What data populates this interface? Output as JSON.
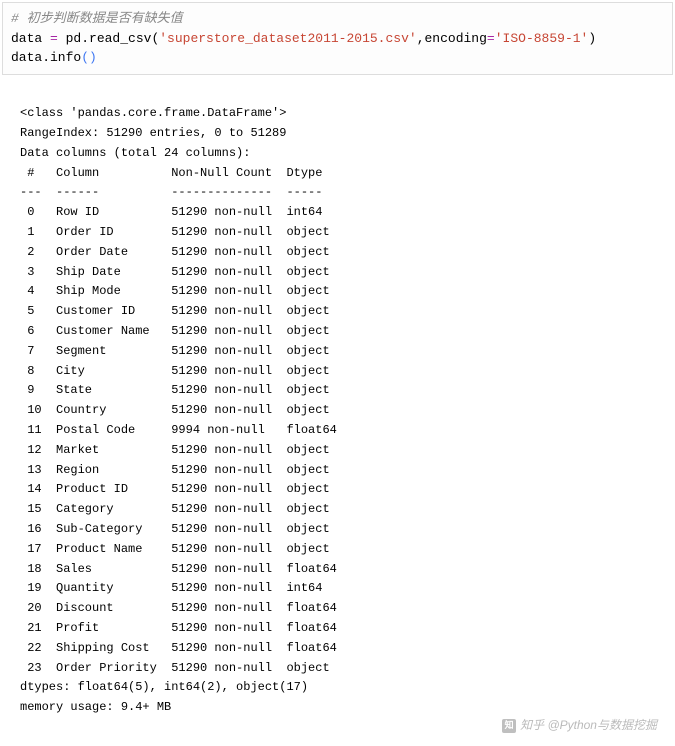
{
  "code": {
    "comment": "# 初步判断数据是否有缺失值",
    "line2_a": "data ",
    "line2_op": "=",
    "line2_b": " pd.read_csv(",
    "line2_str1": "'superstore_dataset2011-2015.csv'",
    "line2_c": ",encoding",
    "line2_op2": "=",
    "line2_str2": "'ISO-8859-1'",
    "line2_d": ")",
    "line3_a": "data.info",
    "line3_p1": "(",
    "line3_p2": ")"
  },
  "output": {
    "class_line": "<class 'pandas.core.frame.DataFrame'>",
    "range_index": "RangeIndex: 51290 entries, 0 to 51289",
    "data_cols": "Data columns (total 24 columns):",
    "header": " #   Column          Non-Null Count  Dtype  ",
    "divider": "---  ------          --------------  -----  ",
    "rows": [
      " 0   Row ID          51290 non-null  int64  ",
      " 1   Order ID        51290 non-null  object ",
      " 2   Order Date      51290 non-null  object ",
      " 3   Ship Date       51290 non-null  object ",
      " 4   Ship Mode       51290 non-null  object ",
      " 5   Customer ID     51290 non-null  object ",
      " 6   Customer Name   51290 non-null  object ",
      " 7   Segment         51290 non-null  object ",
      " 8   City            51290 non-null  object ",
      " 9   State           51290 non-null  object ",
      " 10  Country         51290 non-null  object ",
      " 11  Postal Code     9994 non-null   float64",
      " 12  Market          51290 non-null  object ",
      " 13  Region          51290 non-null  object ",
      " 14  Product ID      51290 non-null  object ",
      " 15  Category        51290 non-null  object ",
      " 16  Sub-Category    51290 non-null  object ",
      " 17  Product Name    51290 non-null  object ",
      " 18  Sales           51290 non-null  float64",
      " 19  Quantity        51290 non-null  int64  ",
      " 20  Discount        51290 non-null  float64",
      " 21  Profit          51290 non-null  float64",
      " 22  Shipping Cost   51290 non-null  float64",
      " 23  Order Priority  51290 non-null  object "
    ],
    "dtypes": "dtypes: float64(5), int64(2), object(17)",
    "memory": "memory usage: 9.4+ MB"
  },
  "watermark": {
    "icon": "知",
    "text": "知乎 @Python与数据挖掘"
  }
}
